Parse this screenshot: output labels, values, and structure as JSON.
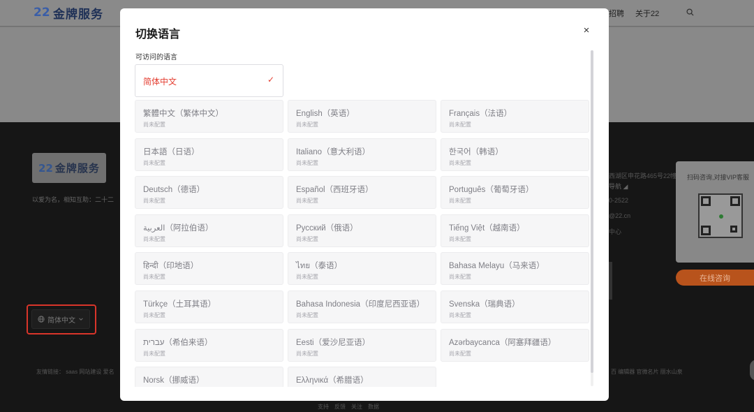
{
  "underlay": {
    "logo_text": "金牌服务",
    "logo_mark": "22",
    "nav": [
      "招聘",
      "关于22"
    ],
    "footer_slogan": "以爱为名，相知互助：二十二",
    "language_button": "简体中文",
    "friend_links": "友情链接：  saas   网站建设   爱名",
    "friend_links_right": "百   编辑器   官微名片   丽水山泉",
    "right_info": [
      "西湖区申花路465号22幢",
      "导航 ◢",
      "0-2522",
      "@22.cn",
      "中心"
    ],
    "contact_title": "扫码咨询,对接VIP客服",
    "consult_button": "在线咨询",
    "bottom_bar": [
      "支持",
      "反馈",
      "关注",
      "数据"
    ]
  },
  "modal": {
    "title": "切换语言",
    "close_glyph": "×",
    "section_label": "可访问的语言",
    "check_glyph": "✓",
    "active_language": "简体中文",
    "languages": [
      {
        "name": "繁體中文（繁体中文）",
        "status": "尚未配置"
      },
      {
        "name": "English（英语）",
        "status": "尚未配置"
      },
      {
        "name": "Français（法语）",
        "status": "尚未配置"
      },
      {
        "name": "日本語（日语）",
        "status": "尚未配置"
      },
      {
        "name": "Italiano（意大利语）",
        "status": "尚未配置"
      },
      {
        "name": "한국어（韩语）",
        "status": "尚未配置"
      },
      {
        "name": "Deutsch（德语）",
        "status": "尚未配置"
      },
      {
        "name": "Español（西班牙语）",
        "status": "尚未配置"
      },
      {
        "name": "Português（葡萄牙语）",
        "status": "尚未配置"
      },
      {
        "name": "العربية（阿拉伯语）",
        "status": "尚未配置"
      },
      {
        "name": "Русский（俄语）",
        "status": "尚未配置"
      },
      {
        "name": "Tiếng Việt（越南语）",
        "status": "尚未配置"
      },
      {
        "name": "हिन्दी（印地语）",
        "status": "尚未配置"
      },
      {
        "name": "ไทย（泰语）",
        "status": "尚未配置"
      },
      {
        "name": "Bahasa Melayu（马来语）",
        "status": "尚未配置"
      },
      {
        "name": "Türkçe（土耳其语）",
        "status": "尚未配置"
      },
      {
        "name": "Bahasa Indonesia（印度尼西亚语）",
        "status": "尚未配置"
      },
      {
        "name": "Svenska（瑞典语）",
        "status": "尚未配置"
      },
      {
        "name": "עברית（希伯来语）",
        "status": "尚未配置"
      },
      {
        "name": "Eesti（爱沙尼亚语）",
        "status": "尚未配置"
      },
      {
        "name": "Azərbaycanca（阿塞拜疆语）",
        "status": "尚未配置"
      },
      {
        "name": "Norsk（挪威语）",
        "status": ""
      },
      {
        "name": "Ελληνικά（希腊语）",
        "status": ""
      }
    ]
  }
}
